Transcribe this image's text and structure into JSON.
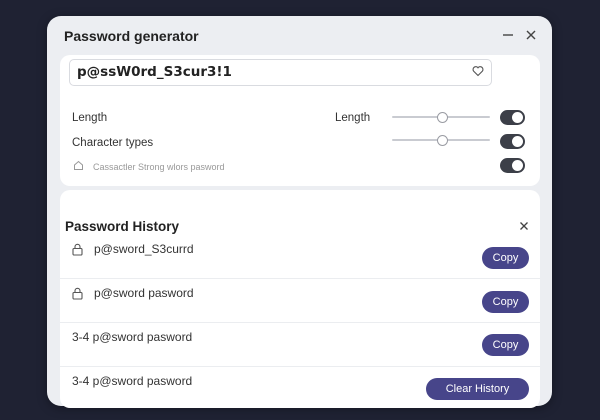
{
  "window": {
    "title": "Password generator",
    "icons": [
      "minimize-icon",
      "close-icon"
    ]
  },
  "generator": {
    "password": "p@ssW0rd_S3cur3!1",
    "favorite_icon": "heart-icon",
    "rows": [
      {
        "label": "Length",
        "secondary_label": "Length",
        "slider_value": 0.52,
        "toggle_on": true
      },
      {
        "label": "Character types",
        "slider_value": 0.52,
        "toggle_on": true
      },
      {
        "label": "Cassactler Strong wlors pasword",
        "icon": "home-icon",
        "toggle_on": true
      }
    ]
  },
  "history": {
    "title": "Password History",
    "close_icon": "close-icon",
    "items": [
      {
        "text": "p@sword_S3currd",
        "lock_icon": true,
        "button": "Copy"
      },
      {
        "text": "p@sword pasword",
        "lock_icon": true,
        "button": "Copy"
      },
      {
        "text": "3-4 p@sword pasword",
        "lock_icon": false,
        "button": "Copy"
      },
      {
        "text": "3-4 p@sword pasword",
        "lock_icon": false,
        "button": "Clear History"
      }
    ]
  },
  "colors": {
    "background": "#1f2233",
    "window": "#eceef2",
    "card": "#ffffff",
    "accent_button": "#47458a",
    "toggle": "#3c3f48"
  }
}
